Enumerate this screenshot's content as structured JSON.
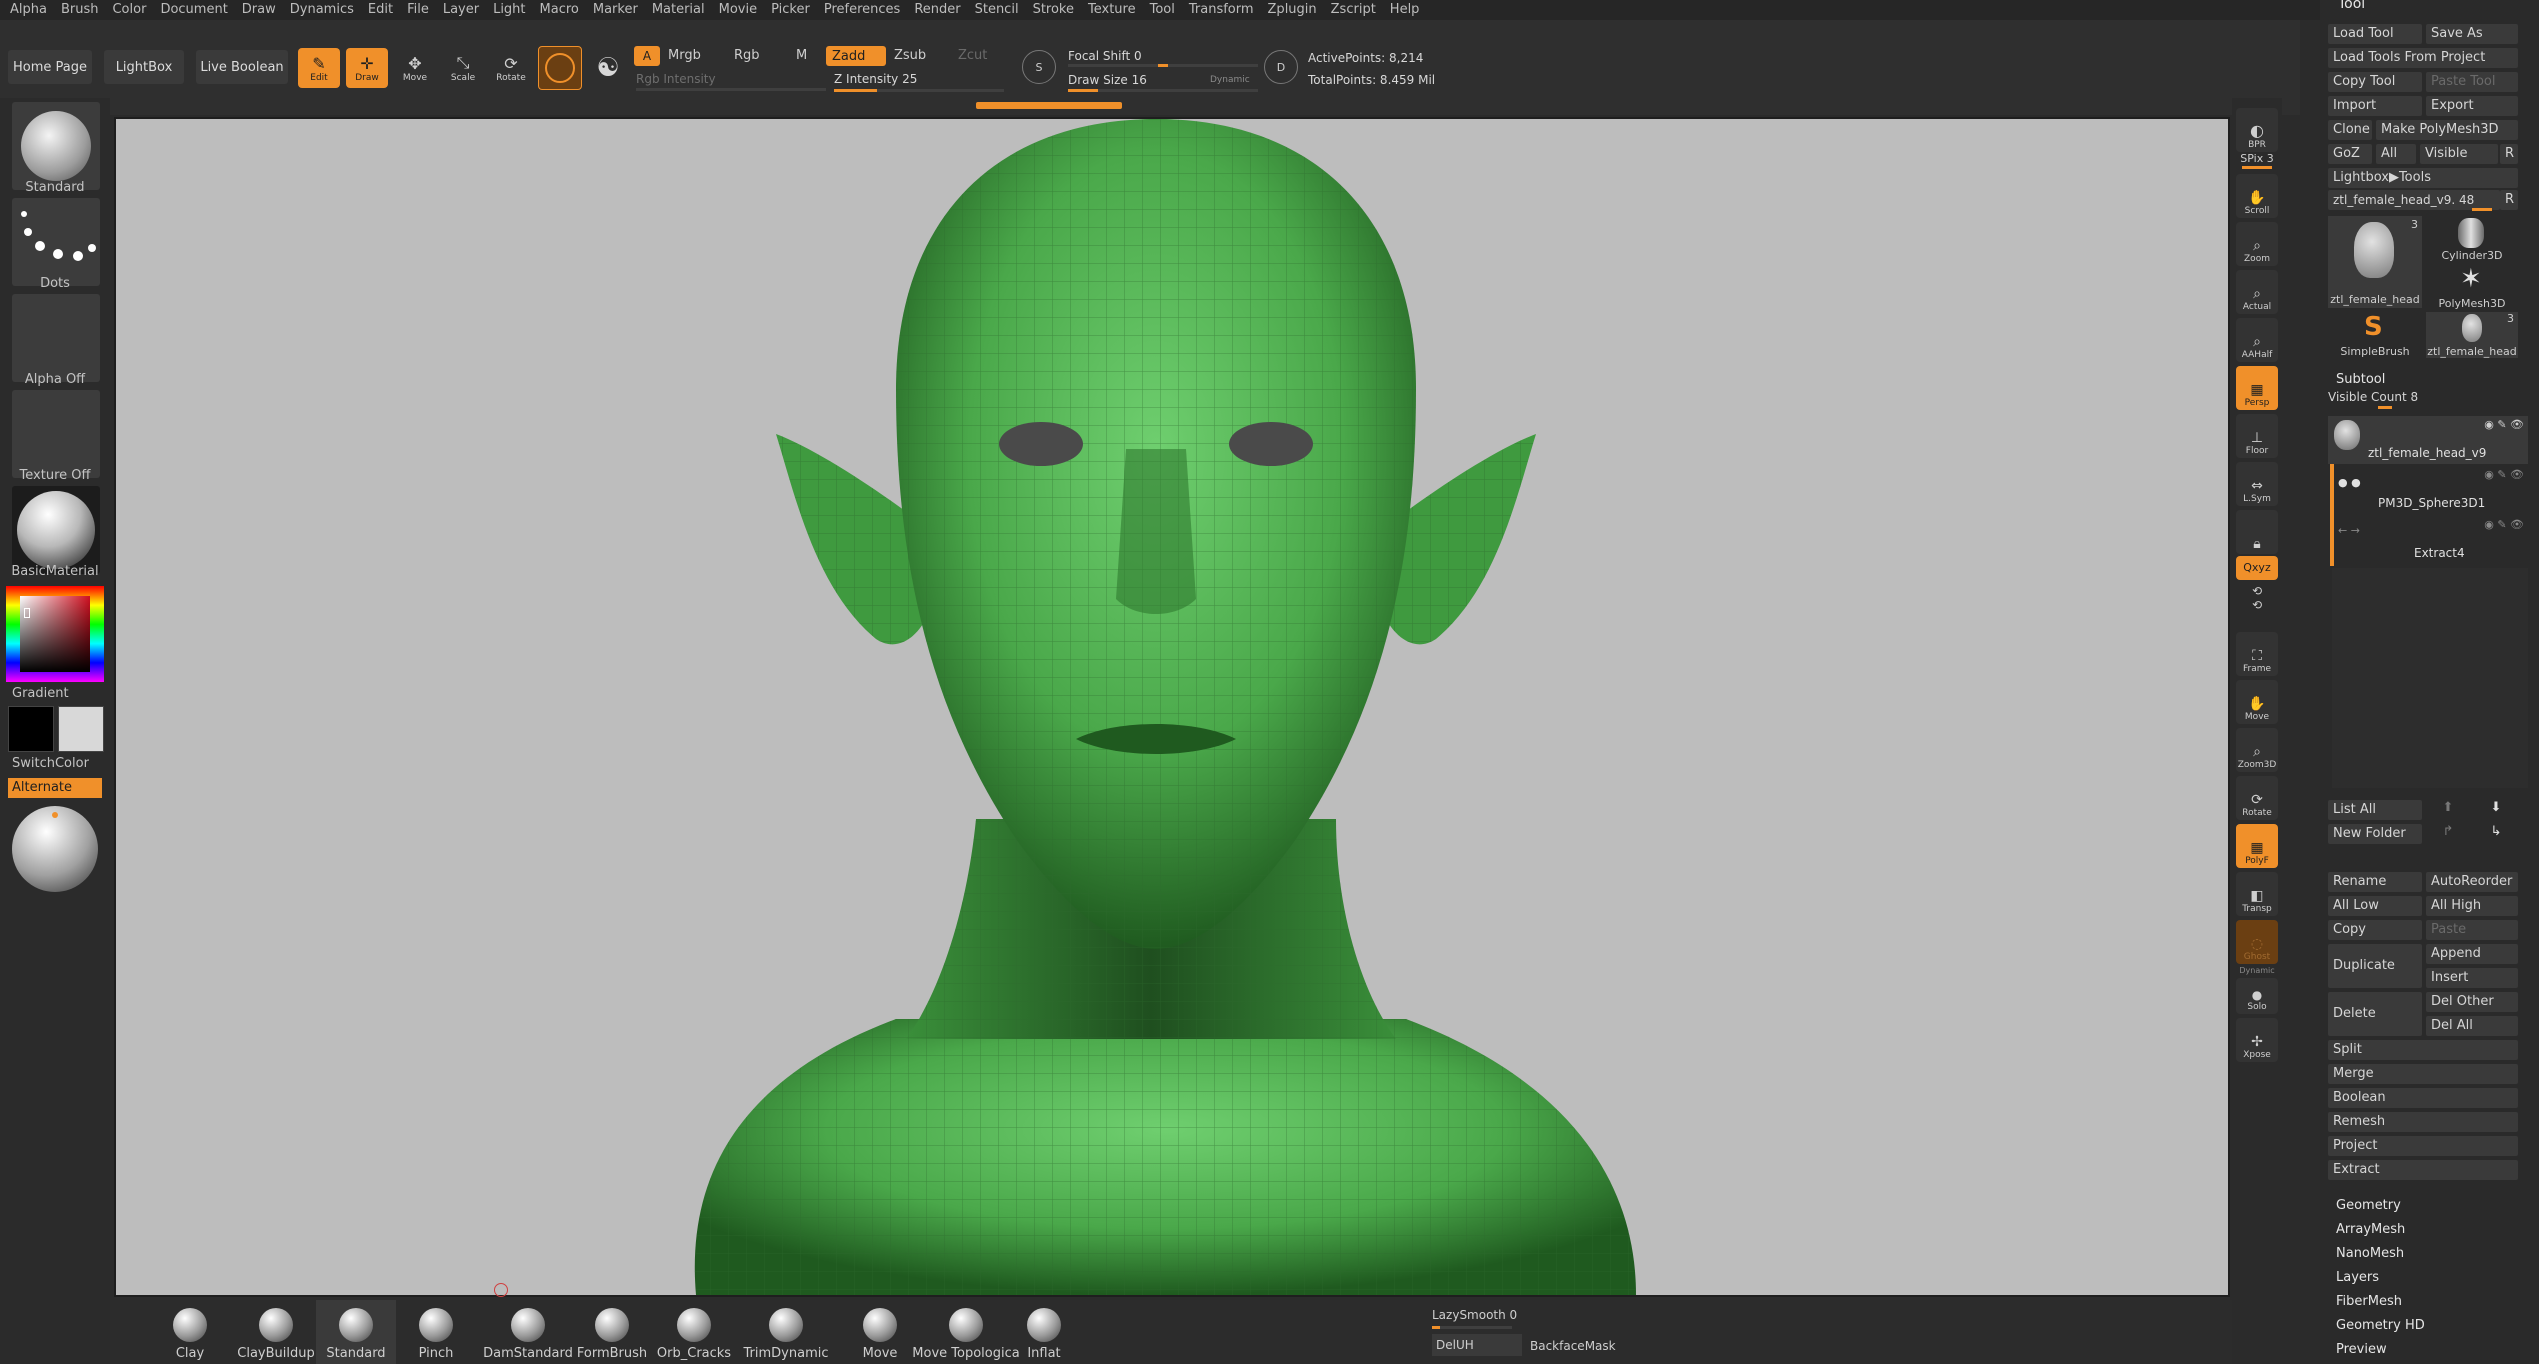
{
  "menu": [
    "Alpha",
    "Brush",
    "Color",
    "Document",
    "Draw",
    "Dynamics",
    "Edit",
    "File",
    "Layer",
    "Light",
    "Macro",
    "Marker",
    "Material",
    "Movie",
    "Picker",
    "Preferences",
    "Render",
    "Stencil",
    "Stroke",
    "Texture",
    "Tool",
    "Transform",
    "Zplugin",
    "Zscript",
    "Help"
  ],
  "shelf": {
    "home_page": "Home Page",
    "lightbox": "LightBox",
    "live_boolean": "Live Boolean",
    "edit": "Edit",
    "draw": "Draw",
    "move": "Move",
    "scale": "Scale",
    "rotate": "Rotate",
    "a_label": "A",
    "mrgb": "Mrgb",
    "rgb": "Rgb",
    "m": "M",
    "rgb_intensity": "Rgb Intensity",
    "zadd": "Zadd",
    "zsub": "Zsub",
    "zcut": "Zcut",
    "z_intensity": "Z Intensity 25",
    "focal_shift": "Focal Shift 0",
    "draw_size": "Draw Size 16",
    "dynamic": "Dynamic",
    "active_points": "ActivePoints: 8,214",
    "total_points": "TotalPoints: 8.459 Mil",
    "z_intensity_fill": 0.25,
    "draw_size_fill": 0.16
  },
  "left": {
    "brush": "Standard",
    "stroke": "Dots",
    "alpha": "Alpha Off",
    "texture": "Texture Off",
    "material": "BasicMaterial",
    "gradient": "Gradient",
    "switchcolor": "SwitchColor",
    "alternate": "Alternate"
  },
  "bottom": {
    "brushes": [
      "Clay",
      "ClayBuildup",
      "Standard",
      "Pinch",
      "DamStandard",
      "FormBrush",
      "Orb_Cracks",
      "TrimDynamic",
      "Move",
      "Move Topologica",
      "Inflat"
    ],
    "lazysmooth": "LazySmooth 0",
    "deluh": "DelUH",
    "backfacemask": "BackfaceMask"
  },
  "right": {
    "bpr": "BPR",
    "spix": "SPix 3",
    "scroll": "Scroll",
    "zoom": "Zoom",
    "actual": "Actual",
    "aahalf": "AAHalf",
    "persp": "Persp",
    "floor": "Floor",
    "lsym": "L.Sym",
    "lock": "",
    "qxyz": "Qxyz",
    "frame": "Frame",
    "move": "Move",
    "zoom3d": "Zoom3D",
    "rotate": "Rotate",
    "polyf": "PolyF",
    "transp": "Transp",
    "ghost": "Ghost",
    "dynamic": "Dynamic",
    "solo": "Solo",
    "xpose": "Xpose"
  },
  "tool": {
    "title": "Tool",
    "load_tool": "Load Tool",
    "save_as": "Save As",
    "load_from_project": "Load Tools From Project",
    "copy_tool": "Copy Tool",
    "paste_tool": "Paste Tool",
    "import": "Import",
    "export": "Export",
    "clone": "Clone",
    "make_polymesh": "Make PolyMesh3D",
    "goz": "GoZ",
    "all": "All",
    "visible": "Visible",
    "r": "R",
    "lightbox_tools": "Lightbox▶Tools",
    "current_tool": "ztl_female_head_v9. 48",
    "thumbs": [
      {
        "label": "ztl_female_head",
        "badge": "3"
      },
      {
        "label": "Cylinder3D",
        "badge": ""
      },
      {
        "label": "PolyMesh3D",
        "badge": ""
      },
      {
        "label": "SimpleBrush",
        "badge": ""
      },
      {
        "label": "ztl_female_head",
        "badge": "3"
      }
    ],
    "subtool": "Subtool",
    "visible_count": "Visible Count 8",
    "subtools": [
      "ztl_female_head_v9",
      "PM3D_Sphere3D1",
      "Extract4"
    ],
    "list_all": "List All",
    "new_folder": "New Folder",
    "rename": "Rename",
    "autoreorder": "AutoReorder",
    "all_low": "All Low",
    "all_high": "All High",
    "copy": "Copy",
    "paste": "Paste",
    "duplicate": "Duplicate",
    "append": "Append",
    "insert": "Insert",
    "delete": "Delete",
    "del_other": "Del Other",
    "del_all": "Del All",
    "split": "Split",
    "merge": "Merge",
    "boolean": "Boolean",
    "remesh": "Remesh",
    "project": "Project",
    "extract": "Extract",
    "sections": [
      "Geometry",
      "ArrayMesh",
      "NanoMesh",
      "Layers",
      "FiberMesh",
      "Geometry HD",
      "Preview"
    ]
  },
  "colors": {
    "accent": "#f0902a",
    "mesh": "#4fae4f",
    "viewport_bg": "#bdbdbd"
  }
}
